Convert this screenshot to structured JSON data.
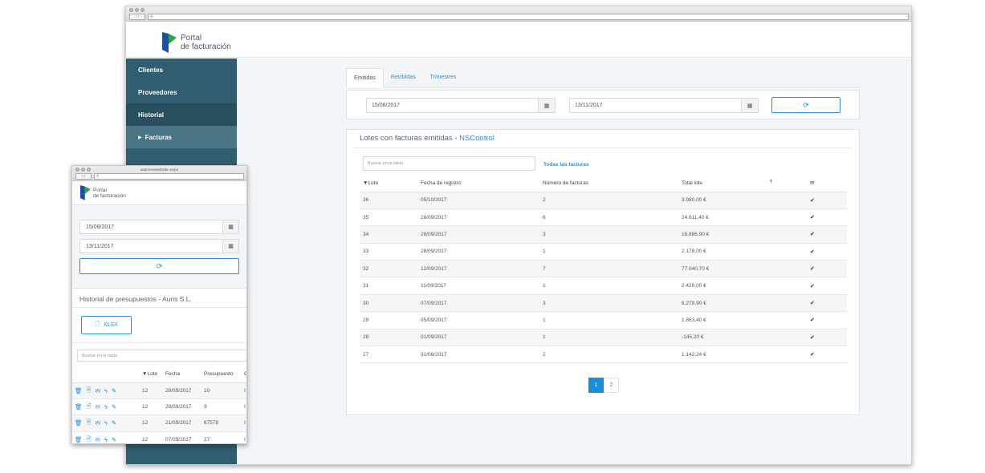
{
  "big": {
    "logo": {
      "line1": "Portal",
      "line2": "de facturación"
    },
    "sidebar": [
      {
        "label": "Clientes"
      },
      {
        "label": "Proveedores"
      },
      {
        "label": "Historial"
      },
      {
        "label": "Facturas"
      }
    ],
    "tabs": [
      {
        "label": "Emitidas",
        "active": true
      },
      {
        "label": "Recibidas",
        "active": false
      },
      {
        "label": "Trimestres",
        "active": false
      }
    ],
    "date_from": "15/08/2017",
    "date_to": "13/11/2017",
    "panel_title": "Lotes con facturas emitidas - ",
    "panel_client": "NSControl",
    "search_placeholder": "Buscar en la tabla",
    "all_invoices_link": "Todas las facturas",
    "columns": [
      "▼Lote",
      "Fecha de registro",
      "Número de facturas",
      "Total lote"
    ],
    "rows": [
      {
        "lote": "36",
        "fecha": "05/10/2017",
        "num": "2",
        "total": "3.980,00 €"
      },
      {
        "lote": "35",
        "fecha": "28/09/2017",
        "num": "6",
        "total": "24.611,40 €"
      },
      {
        "lote": "34",
        "fecha": "28/09/2017",
        "num": "3",
        "total": "16.886,90 €"
      },
      {
        "lote": "33",
        "fecha": "28/09/2017",
        "num": "1",
        "total": "2.178,00 €"
      },
      {
        "lote": "32",
        "fecha": "12/09/2017",
        "num": "7",
        "total": "77.040,70 €"
      },
      {
        "lote": "31",
        "fecha": "11/09/2017",
        "num": "1",
        "total": "2.420,00 €"
      },
      {
        "lote": "30",
        "fecha": "07/09/2017",
        "num": "3",
        "total": "6.279,90 €"
      },
      {
        "lote": "29",
        "fecha": "05/09/2017",
        "num": "1",
        "total": "1.863,40 €"
      },
      {
        "lote": "28",
        "fecha": "01/09/2017",
        "num": "1",
        "total": "-145,20 €"
      },
      {
        "lote": "27",
        "fecha": "31/08/2017",
        "num": "2",
        "total": "1.142,24 €"
      }
    ],
    "pages": [
      "1",
      "2"
    ]
  },
  "small": {
    "window_title": "ausmoviowebsite.corpo",
    "logo": {
      "line1": "Portal",
      "line2": "de facturación"
    },
    "date_from": "15/08/2017",
    "date_to": "13/11/2017",
    "card_title": "Historial de presupuestos - Auris S.L.",
    "xlsx_label": "XLSX",
    "search_placeholder": "Buscar en la tabla",
    "columns": [
      "▼Lote",
      "Fecha",
      "Presupuesto",
      "C"
    ],
    "rows": [
      {
        "lote": "12",
        "fecha": "28/09/2017",
        "presupuesto": "10",
        "extra": "I"
      },
      {
        "lote": "12",
        "fecha": "28/09/2017",
        "presupuesto": "9",
        "extra": "I"
      },
      {
        "lote": "12",
        "fecha": "21/09/2017",
        "presupuesto": "67578",
        "extra": "I"
      },
      {
        "lote": "12",
        "fecha": "07/09/2017",
        "presupuesto": "27",
        "extra": "I"
      }
    ]
  },
  "colors": {
    "accent": "#1a8cd8",
    "sidebar": "#305d6f",
    "sidebar_active": "#284f5e"
  }
}
